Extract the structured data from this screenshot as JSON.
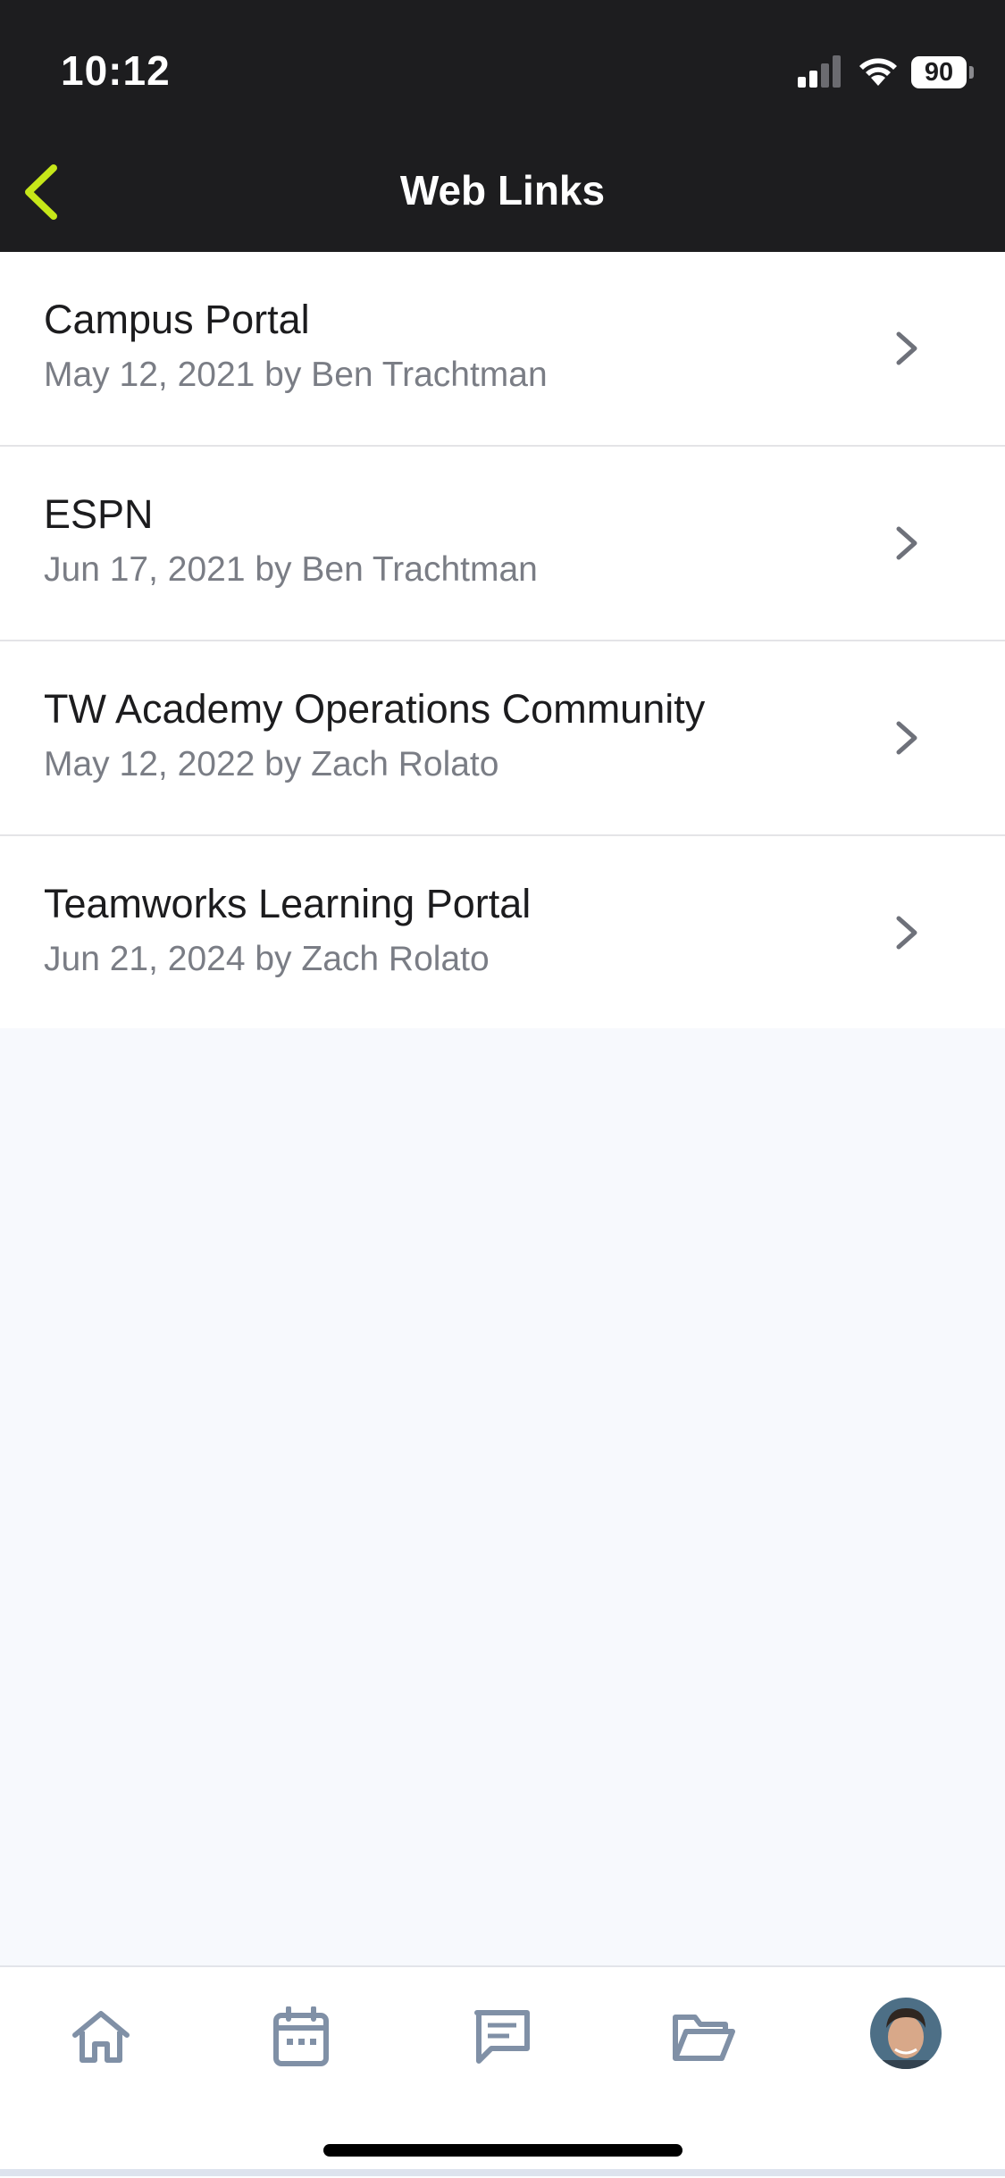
{
  "status_bar": {
    "time": "10:12",
    "battery": "90",
    "signal_icon": "cellular-signal-icon",
    "wifi_icon": "wifi-icon"
  },
  "nav": {
    "title": "Web Links",
    "back_icon": "chevron-left-icon",
    "accent_color": "#c6e719"
  },
  "links": [
    {
      "title": "Campus Portal",
      "meta": "May 12, 2021 by Ben Trachtman"
    },
    {
      "title": "ESPN",
      "meta": "Jun 17, 2021 by Ben Trachtman"
    },
    {
      "title": "TW Academy Operations Community",
      "meta": "May 12, 2022 by Zach Rolato"
    },
    {
      "title": "Teamworks Learning Portal",
      "meta": "Jun 21, 2024 by Zach Rolato"
    }
  ],
  "tab_bar": {
    "tabs": [
      "home-icon",
      "calendar-icon",
      "messages-icon",
      "folder-icon",
      "profile-avatar"
    ]
  }
}
